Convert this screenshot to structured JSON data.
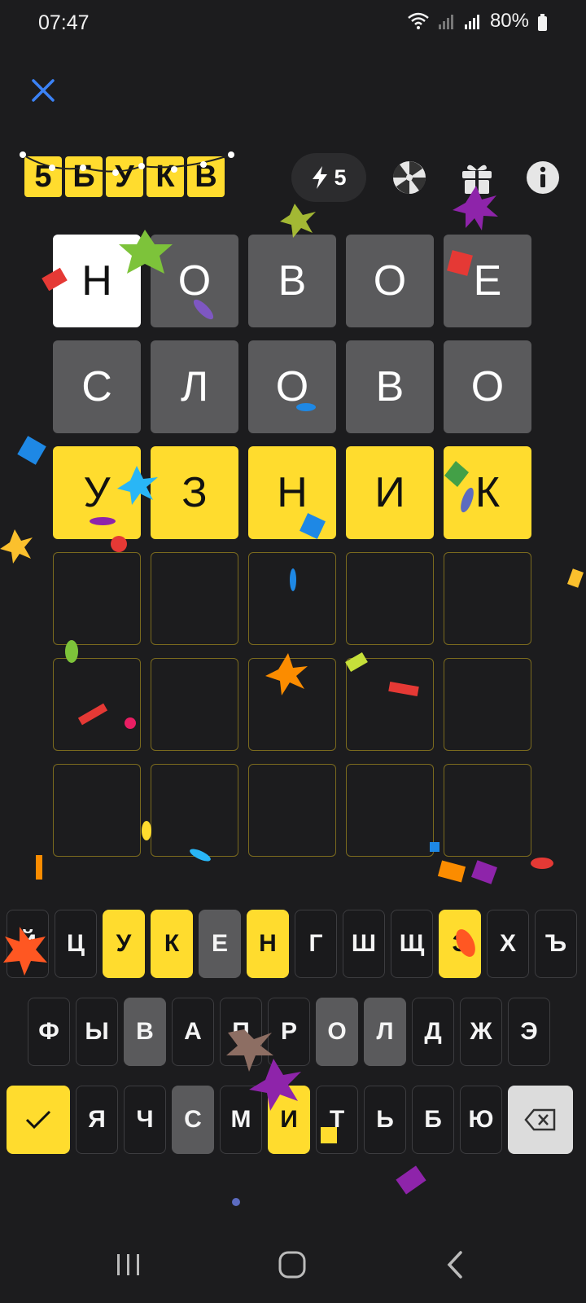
{
  "status_bar": {
    "time": "07:47",
    "battery": "80%"
  },
  "header": {
    "logo_letters": [
      "5",
      "Б",
      "У",
      "К",
      "В"
    ],
    "energy_count": "5"
  },
  "grid": [
    [
      {
        "l": "Н",
        "s": "active"
      },
      {
        "l": "О",
        "s": "absent"
      },
      {
        "l": "В",
        "s": "absent"
      },
      {
        "l": "О",
        "s": "absent"
      },
      {
        "l": "Е",
        "s": "absent"
      }
    ],
    [
      {
        "l": "С",
        "s": "absent"
      },
      {
        "l": "Л",
        "s": "absent"
      },
      {
        "l": "О",
        "s": "absent"
      },
      {
        "l": "В",
        "s": "absent"
      },
      {
        "l": "О",
        "s": "absent"
      }
    ],
    [
      {
        "l": "У",
        "s": "present"
      },
      {
        "l": "З",
        "s": "present"
      },
      {
        "l": "Н",
        "s": "present"
      },
      {
        "l": "И",
        "s": "present"
      },
      {
        "l": "К",
        "s": "present"
      }
    ],
    [
      {
        "l": "",
        "s": "empty"
      },
      {
        "l": "",
        "s": "empty"
      },
      {
        "l": "",
        "s": "empty"
      },
      {
        "l": "",
        "s": "empty"
      },
      {
        "l": "",
        "s": "empty"
      }
    ],
    [
      {
        "l": "",
        "s": "empty"
      },
      {
        "l": "",
        "s": "empty"
      },
      {
        "l": "",
        "s": "empty"
      },
      {
        "l": "",
        "s": "empty"
      },
      {
        "l": "",
        "s": "empty"
      }
    ],
    [
      {
        "l": "",
        "s": "empty"
      },
      {
        "l": "",
        "s": "empty"
      },
      {
        "l": "",
        "s": "empty"
      },
      {
        "l": "",
        "s": "empty"
      },
      {
        "l": "",
        "s": "empty"
      }
    ]
  ],
  "keyboard": {
    "row1": [
      {
        "k": "Й",
        "s": "n"
      },
      {
        "k": "Ц",
        "s": "n"
      },
      {
        "k": "У",
        "s": "present"
      },
      {
        "k": "К",
        "s": "present"
      },
      {
        "k": "Е",
        "s": "absent"
      },
      {
        "k": "Н",
        "s": "present"
      },
      {
        "k": "Г",
        "s": "n"
      },
      {
        "k": "Ш",
        "s": "n"
      },
      {
        "k": "Щ",
        "s": "n"
      },
      {
        "k": "З",
        "s": "present"
      },
      {
        "k": "Х",
        "s": "n"
      },
      {
        "k": "Ъ",
        "s": "n"
      }
    ],
    "row2": [
      {
        "k": "Ф",
        "s": "n"
      },
      {
        "k": "Ы",
        "s": "n"
      },
      {
        "k": "В",
        "s": "absent"
      },
      {
        "k": "А",
        "s": "n"
      },
      {
        "k": "П",
        "s": "n"
      },
      {
        "k": "Р",
        "s": "n"
      },
      {
        "k": "О",
        "s": "absent"
      },
      {
        "k": "Л",
        "s": "absent"
      },
      {
        "k": "Д",
        "s": "n"
      },
      {
        "k": "Ж",
        "s": "n"
      },
      {
        "k": "Э",
        "s": "n"
      }
    ],
    "row3": [
      {
        "k": "Я",
        "s": "n"
      },
      {
        "k": "Ч",
        "s": "n"
      },
      {
        "k": "С",
        "s": "absent"
      },
      {
        "k": "М",
        "s": "n"
      },
      {
        "k": "И",
        "s": "present"
      },
      {
        "k": "Т",
        "s": "n"
      },
      {
        "k": "Ь",
        "s": "n"
      },
      {
        "k": "Б",
        "s": "n"
      },
      {
        "k": "Ю",
        "s": "n"
      }
    ]
  },
  "colors": {
    "present": "#ffdc2e",
    "absent": "#5a5a5c",
    "background": "#1c1c1e",
    "accent_close": "#3b82f6"
  },
  "icons": [
    "close-icon",
    "energy-bolt-icon",
    "wheel-icon",
    "gift-icon",
    "info-icon",
    "check-icon",
    "backspace-icon",
    "recent-apps-icon",
    "home-icon",
    "back-icon"
  ]
}
